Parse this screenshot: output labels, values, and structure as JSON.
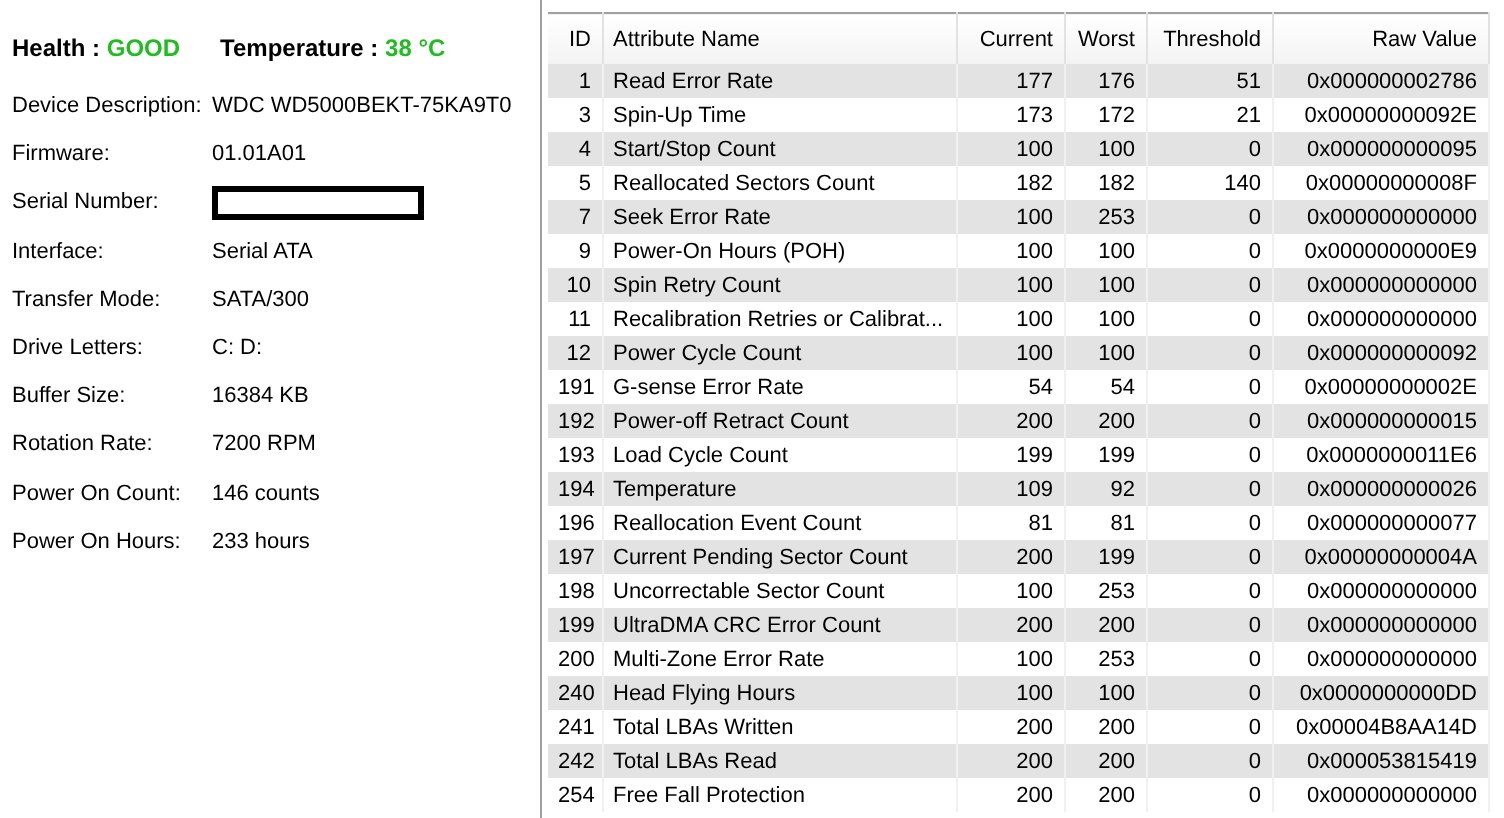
{
  "summary": [
    {
      "label": "Health :",
      "value": "GOOD",
      "color": "#22bb22"
    },
    {
      "label": "Temperature :",
      "value": "38 °C",
      "color": "#22bb22"
    }
  ],
  "details": [
    {
      "label": "Device Description:",
      "value": "WDC WD5000BEKT-75KA9T0"
    },
    {
      "label": "Firmware:",
      "value": "01.01A01"
    },
    {
      "label": "Serial Number:",
      "kind": "redacted"
    },
    {
      "label": "Interface:",
      "value": "Serial ATA"
    },
    {
      "label": "Transfer Mode:",
      "value": "SATA/300"
    },
    {
      "label": "Drive Letters:",
      "value": "C: D:"
    },
    {
      "label": "Buffer Size:",
      "value": "16384 KB"
    },
    {
      "label": "Rotation Rate:",
      "value": "7200 RPM"
    },
    {
      "label": "Power On Count:",
      "value": "146 counts"
    },
    {
      "label": "Power On Hours:",
      "value": "233 hours"
    }
  ],
  "table": {
    "columns": [
      "ID",
      "Attribute Name",
      "Current",
      "Worst",
      "Threshold",
      "Raw Value"
    ],
    "rows": [
      [
        "1",
        "Read Error Rate",
        "177",
        "176",
        "51",
        "0x000000002786"
      ],
      [
        "3",
        "Spin-Up Time",
        "173",
        "172",
        "21",
        "0x00000000092E"
      ],
      [
        "4",
        "Start/Stop Count",
        "100",
        "100",
        "0",
        "0x000000000095"
      ],
      [
        "5",
        "Reallocated Sectors Count",
        "182",
        "182",
        "140",
        "0x00000000008F"
      ],
      [
        "7",
        "Seek Error Rate",
        "100",
        "253",
        "0",
        "0x000000000000"
      ],
      [
        "9",
        "Power-On Hours (POH)",
        "100",
        "100",
        "0",
        "0x0000000000E9"
      ],
      [
        "10",
        "Spin Retry Count",
        "100",
        "100",
        "0",
        "0x000000000000"
      ],
      [
        "11",
        "Recalibration Retries or Calibrat...",
        "100",
        "100",
        "0",
        "0x000000000000"
      ],
      [
        "12",
        "Power Cycle Count",
        "100",
        "100",
        "0",
        "0x000000000092"
      ],
      [
        "191",
        "G-sense Error Rate",
        "54",
        "54",
        "0",
        "0x00000000002E"
      ],
      [
        "192",
        "Power-off Retract Count",
        "200",
        "200",
        "0",
        "0x000000000015"
      ],
      [
        "193",
        "Load Cycle Count",
        "199",
        "199",
        "0",
        "0x0000000011E6"
      ],
      [
        "194",
        "Temperature",
        "109",
        "92",
        "0",
        "0x000000000026"
      ],
      [
        "196",
        "Reallocation Event Count",
        "81",
        "81",
        "0",
        "0x000000000077"
      ],
      [
        "197",
        "Current Pending Sector Count",
        "200",
        "199",
        "0",
        "0x00000000004A"
      ],
      [
        "198",
        "Uncorrectable Sector Count",
        "100",
        "253",
        "0",
        "0x000000000000"
      ],
      [
        "199",
        "UltraDMA CRC Error Count",
        "200",
        "200",
        "0",
        "0x000000000000"
      ],
      [
        "200",
        "Multi-Zone Error Rate",
        "100",
        "253",
        "0",
        "0x000000000000"
      ],
      [
        "240",
        "Head Flying Hours",
        "100",
        "100",
        "0",
        "0x0000000000DD"
      ],
      [
        "241",
        "Total LBAs Written",
        "200",
        "200",
        "0",
        "0x00004B8AA14D"
      ],
      [
        "242",
        "Total LBAs Read",
        "200",
        "200",
        "0",
        "0x000053815419"
      ],
      [
        "254",
        "Free Fall Protection",
        "200",
        "200",
        "0",
        "0x000000000000"
      ]
    ]
  }
}
